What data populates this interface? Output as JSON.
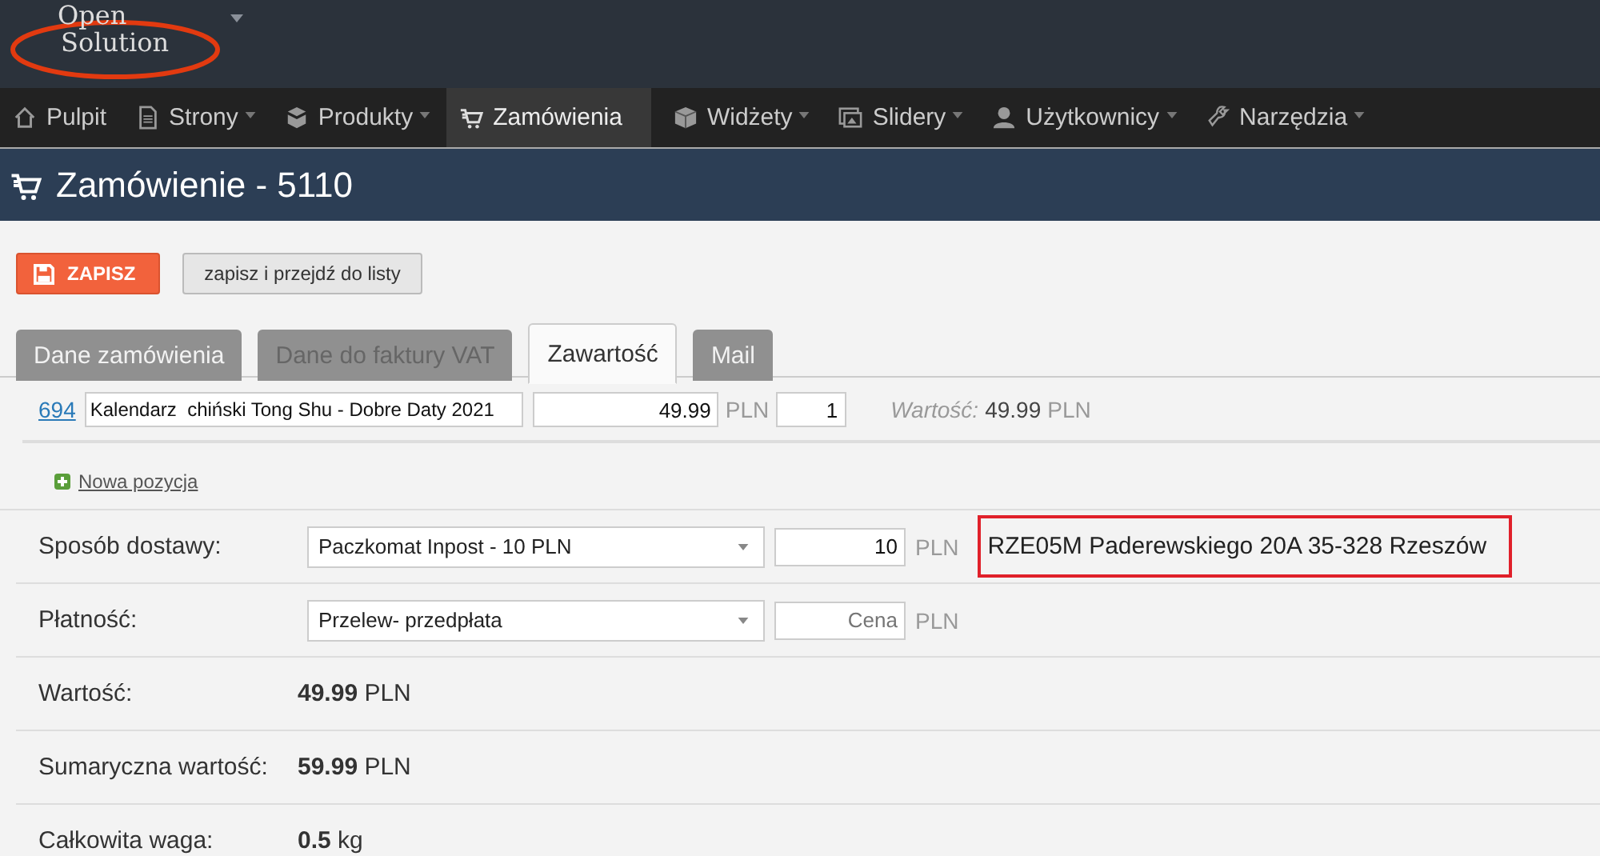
{
  "logo": {
    "line_1": "Open",
    "line_2": "Solution"
  },
  "nav": [
    {
      "label": "Pulpit",
      "kind": "home",
      "caret": false,
      "selected": false
    },
    {
      "label": "Strony",
      "kind": "page",
      "caret": true,
      "selected": false
    },
    {
      "label": "Produkty",
      "kind": "boxes",
      "caret": true,
      "selected": false
    },
    {
      "label": "Zamówienia",
      "kind": "cart",
      "caret": false,
      "selected": true
    },
    {
      "label": "Widżety",
      "kind": "cube",
      "caret": true,
      "selected": false
    },
    {
      "label": "Slidery",
      "kind": "image",
      "caret": true,
      "selected": false
    },
    {
      "label": "Użytkownicy",
      "kind": "user",
      "caret": true,
      "selected": false
    },
    {
      "label": "Narzędzia",
      "kind": "wrench",
      "caret": true,
      "selected": false
    }
  ],
  "page_title": "Zamówienie - 5110",
  "buttons": {
    "save": "ZAPISZ",
    "save_list": "zapisz i przejdź do listy"
  },
  "tabs": [
    {
      "label": "Dane zamówienia",
      "selected": false,
      "disabled": false
    },
    {
      "label": "Dane do faktury VAT",
      "selected": false,
      "disabled": true
    },
    {
      "label": "Zawartość",
      "selected": true,
      "disabled": false
    },
    {
      "label": "Mail",
      "selected": false,
      "disabled": false
    }
  ],
  "item": {
    "id": "694",
    "name": "Kalendarz  chiński Tong Shu - Dobre Daty 2021",
    "price": "49.99",
    "currency": "PLN",
    "quantity": "1",
    "value_label": "Wartość:",
    "value": "49.99",
    "value_currency": "PLN"
  },
  "new_item": "Nowa pozycja",
  "delivery": {
    "label": "Sposób dostawy:",
    "method": "Paczkomat Inpost - 10 PLN",
    "price": "10",
    "currency": "PLN",
    "point": "RZE05M Paderewskiego 20A 35-328 Rzeszów"
  },
  "payment": {
    "label": "Płatność:",
    "method": "Przelew- przedpłata",
    "price_placeholder": "Cena",
    "currency": "PLN"
  },
  "summary": [
    {
      "label": "Wartość:",
      "value": "49.99",
      "unit": "PLN"
    },
    {
      "label": "Sumaryczna wartość:",
      "value": "59.99",
      "unit": "PLN"
    },
    {
      "label": "Całkowita waga:",
      "value": "0.5",
      "unit": "kg"
    }
  ]
}
